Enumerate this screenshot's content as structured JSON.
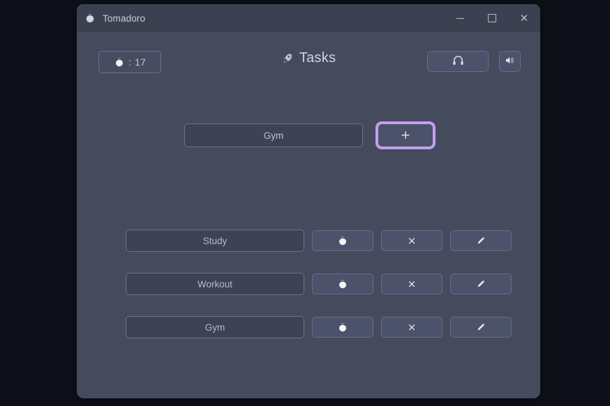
{
  "window": {
    "title": "Tomadoro",
    "app_icon": "tomato-icon",
    "controls": {
      "minimize": "minimize-icon",
      "maximize": "maximize-icon",
      "close": "close-icon"
    }
  },
  "toolbar": {
    "counter": {
      "icon": "tomato-icon",
      "separator": ":",
      "value": "17"
    },
    "page_title": "Tasks",
    "page_title_icon": "rocket-icon",
    "headphones_button": "headphones-icon",
    "speaker_button": "speaker-icon"
  },
  "add_task": {
    "input_value": "Gym",
    "input_placeholder": "",
    "add_label": "+"
  },
  "tasks": [
    {
      "name": "Study",
      "pomodoro_icon": "tomato-icon",
      "delete_label": "×",
      "edit_icon": "pencil-icon"
    },
    {
      "name": "Workout",
      "pomodoro_icon": "tomato-icon",
      "delete_label": "×",
      "edit_icon": "pencil-icon"
    },
    {
      "name": "Gym",
      "pomodoro_icon": "tomato-icon",
      "delete_label": "×",
      "edit_icon": "pencil-icon"
    }
  ],
  "colors": {
    "desktop": "#0e1019",
    "window_bg": "#454a5c",
    "titlebar_bg": "#3c4152",
    "field_bg": "#3d4254",
    "button_bg": "#4c5269",
    "border": "#656d8a",
    "focus_ring": "#c49ef0",
    "text": "#c5c9d4"
  }
}
